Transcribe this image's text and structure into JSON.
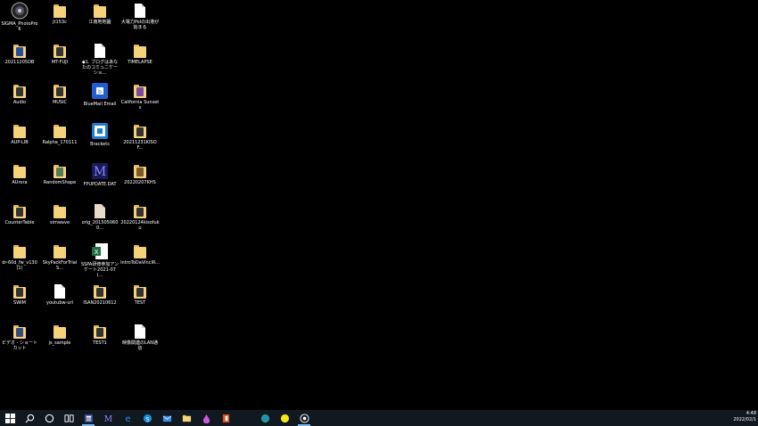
{
  "desktop": {
    "icons": [
      {
        "label": "SIGMA_PhotoPro6",
        "kind": "app-sigma"
      },
      {
        "label": "jt153c",
        "kind": "folder"
      },
      {
        "label": "江南地地圖",
        "kind": "folder"
      },
      {
        "label": "大電力Polの出港が始まる",
        "kind": "file"
      },
      {
        "label": "20211205DB",
        "kind": "folder-blue"
      },
      {
        "label": "MT-FUJI",
        "kind": "folder-dark"
      },
      {
        "label": "◆1. ブログはあなたのコミュニケーショ...",
        "kind": "file"
      },
      {
        "label": "TIMELAPSE",
        "kind": "folder"
      },
      {
        "label": "Audio",
        "kind": "folder-dark"
      },
      {
        "label": "MUSIC",
        "kind": "folder-dark"
      },
      {
        "label": "BlueMail Email",
        "kind": "app-bluemail"
      },
      {
        "label": "California Sunsets",
        "kind": "folder-purple"
      },
      {
        "label": "AUP-LIB",
        "kind": "folder"
      },
      {
        "label": "Ralpha_170111",
        "kind": "folder"
      },
      {
        "label": "Brackets",
        "kind": "app-brackets"
      },
      {
        "label": "20211231KISOF...",
        "kind": "folder-dark"
      },
      {
        "label": "AUrora",
        "kind": "folder"
      },
      {
        "label": "RandomShape",
        "kind": "folder-green"
      },
      {
        "label": "FPUPDATE.DAT",
        "kind": "app-m"
      },
      {
        "label": "20220207KHS",
        "kind": "folder-brown"
      },
      {
        "label": "CounterTable",
        "kind": "folder-dark"
      },
      {
        "label": "simwave",
        "kind": "folder"
      },
      {
        "label": "orig_2015050600...",
        "kind": "file-beige"
      },
      {
        "label": "20220124kisofuku",
        "kind": "folder-dark"
      },
      {
        "label": "dr-60d_fw_v130 (1)",
        "kind": "folder"
      },
      {
        "label": "SkyPackForTrialS...",
        "kind": "folder"
      },
      {
        "label": "SSPA研修参加アンケート2021-07 (...",
        "kind": "app-excel"
      },
      {
        "label": "IntroToDaVinciR...",
        "kind": "folder"
      },
      {
        "label": "SWIM",
        "kind": "folder-dark"
      },
      {
        "label": "youtubw-url",
        "kind": "file"
      },
      {
        "label": "ISAN20210612",
        "kind": "folder-dark"
      },
      {
        "label": "TEST",
        "kind": "folder-dark"
      },
      {
        "label": "ビデオ - ショートカット",
        "kind": "folder-video"
      },
      {
        "label": "js_sample",
        "kind": "folder"
      },
      {
        "label": "TEST1",
        "kind": "folder-dark"
      },
      {
        "label": "映像関連のLAN通信",
        "kind": "file"
      }
    ]
  },
  "taskbar": {
    "items": [
      {
        "name": "start-button",
        "icon": "windows-icon"
      },
      {
        "name": "search-button",
        "icon": "search-icon"
      },
      {
        "name": "cortana-button",
        "icon": "circle-icon"
      },
      {
        "name": "taskview-button",
        "icon": "taskview-icon"
      },
      {
        "name": "taskbar-app-1",
        "icon": "app-window-icon",
        "active": true
      },
      {
        "name": "taskbar-app-m",
        "icon": "m-app-icon"
      },
      {
        "name": "taskbar-ie",
        "icon": "ie-icon"
      },
      {
        "name": "taskbar-skype",
        "icon": "skype-icon"
      },
      {
        "name": "taskbar-mail",
        "icon": "mail-icon"
      },
      {
        "name": "taskbar-explorer",
        "icon": "folder-icon"
      },
      {
        "name": "taskbar-drop",
        "icon": "drop-icon"
      },
      {
        "name": "taskbar-office",
        "icon": "office-icon"
      },
      {
        "name": "taskbar-spacer",
        "icon": "blank"
      },
      {
        "name": "taskbar-edge",
        "icon": "edge-icon"
      },
      {
        "name": "taskbar-yellow",
        "icon": "yellow-circle-icon"
      },
      {
        "name": "taskbar-chrome-like",
        "icon": "globe-icon",
        "active": true
      }
    ],
    "clock": {
      "time": "4:48",
      "date": "2022/02/1"
    }
  }
}
